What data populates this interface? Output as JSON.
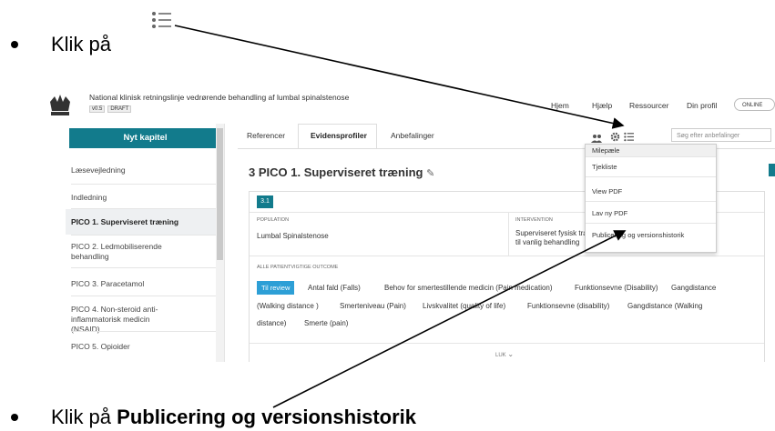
{
  "instructions": {
    "step1_prefix": "Klik på",
    "step2_prefix": "Klik på",
    "step2_bold": "Publicering og versionshistorik"
  },
  "app": {
    "title": "National klinisk retningslinje vedrørende behandling af lumbal spinalstenose",
    "version": "v0.5",
    "status": "DRAFT",
    "nav": [
      "Hjem",
      "Hjælp",
      "Ressourcer",
      "Din profil"
    ],
    "toggle": "ONLINE"
  },
  "sidebar": {
    "new_chapter": "Nyt kapitel",
    "items": [
      {
        "label": "Læsevejledning"
      },
      {
        "label": "Indledning"
      },
      {
        "label": "PICO 1. Superviseret træning"
      },
      {
        "label": "PICO 2. Ledmobiliserende behandling"
      },
      {
        "label": "PICO 3. Paracetamol"
      },
      {
        "label": "PICO 4. Non-steroid anti-inflammatorisk medicin (NSAID)"
      },
      {
        "label": "PICO 5. Opioider"
      }
    ]
  },
  "tabs": [
    "Referencer",
    "Evidensprofiler",
    "Anbefalinger"
  ],
  "search": {
    "placeholder": "Søg efter anbefalinger",
    "button": "Sø"
  },
  "section": {
    "title": "3  PICO 1. Superviseret træning",
    "badge": "3.1",
    "population_label": "POPULATION",
    "population": "Lumbal Spinalstenose",
    "intervention_label": "INTERVENTION",
    "intervention_line1": "Superviseret fysisk træning i tillæg",
    "intervention_line2": "til vanlig behandling",
    "outcome_label": "ALLE PATIENTVIGTIGE OUTCOME",
    "review": "Til review",
    "outcomes_line1": [
      "Antal fald (Falls)",
      "Behov for smertestillende medicin (Pain medication)",
      "Funktionsevne (Disability)",
      "Gangdistance"
    ],
    "outcomes_line2": [
      "(Walking distance )",
      "Smerteniveau (Pain)",
      "Livskvalitet (quality of life)",
      "Funktionsevne (disability)",
      "Gangdistance (Walking"
    ],
    "outcomes_line3": [
      "distance)",
      "Smerte (pain)"
    ],
    "close": "LUK"
  },
  "dropdown": {
    "items": [
      "Milepæle",
      "Tjekliste",
      "View PDF",
      "Lav ny PDF",
      "Publicering og versionshistorik"
    ]
  },
  "colors": {
    "accent": "#127b8c",
    "review": "#2d9fd6"
  }
}
